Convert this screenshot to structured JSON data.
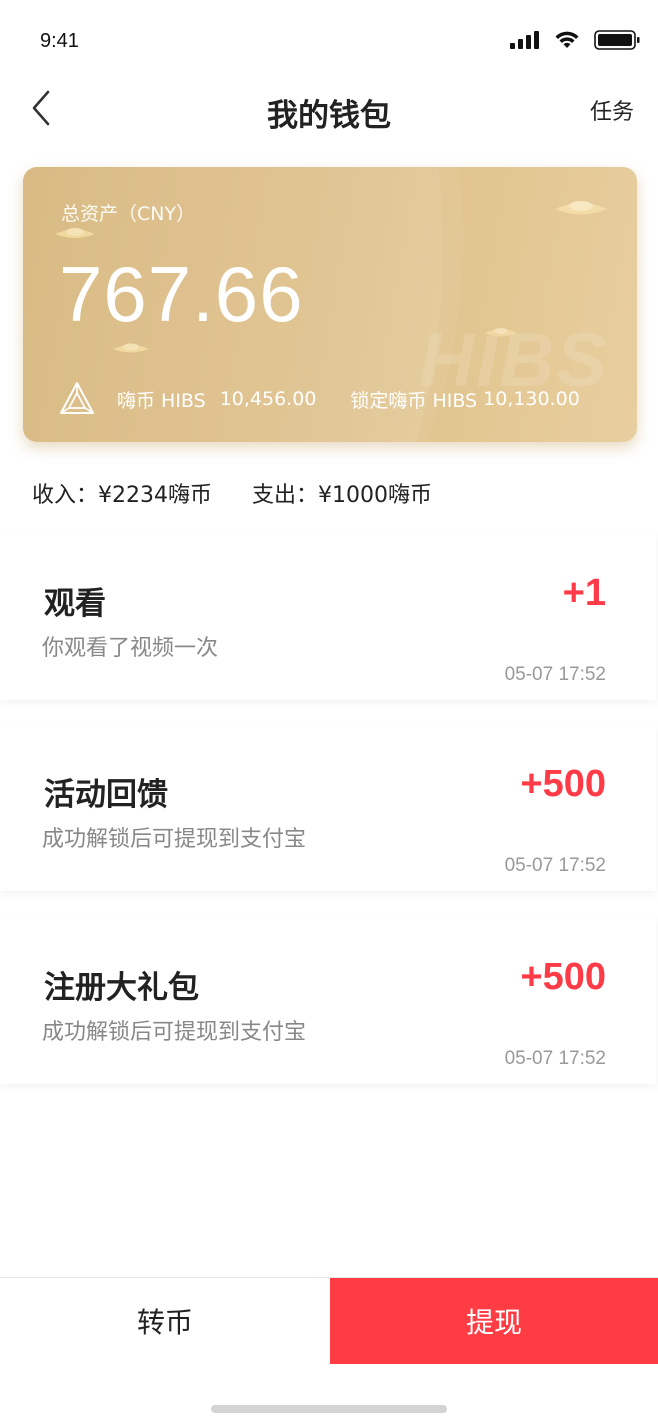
{
  "status_bar": {
    "time": "9:41"
  },
  "nav": {
    "back_icon": "chevron-left-icon",
    "title": "我的钱包",
    "task_label": "任务"
  },
  "wallet_card": {
    "label": "总资产（CNY）",
    "total": "767.66",
    "watermark": "HIBS",
    "logo_icon": "hibs-logo-icon",
    "hibs_label": "嗨币 HIBS",
    "hibs_value": "10,456.00",
    "locked_label": "锁定嗨币 HIBS",
    "locked_value": "10,130.00",
    "colors": {
      "gradient_start": "#d4b173",
      "gradient_end": "#e8cf9f"
    }
  },
  "summary": {
    "income": "收入：¥2234嗨币",
    "expense": "支出：¥1000嗨币"
  },
  "transactions": [
    {
      "title": "观看",
      "desc": "你观看了视频一次",
      "amount": "+1",
      "time": "05-07 17:52"
    },
    {
      "title": "活动回馈",
      "desc": "成功解锁后可提现到支付宝",
      "amount": "+500",
      "time": "05-07 17:52"
    },
    {
      "title": "注册大礼包",
      "desc": "成功解锁后可提现到支付宝",
      "amount": "+500",
      "time": "05-07 17:52"
    }
  ],
  "bottom_bar": {
    "transfer_label": "转币",
    "withdraw_label": "提现",
    "accent_color": "#ff3b44"
  },
  "colors": {
    "amount_red": "#ff3b47"
  }
}
